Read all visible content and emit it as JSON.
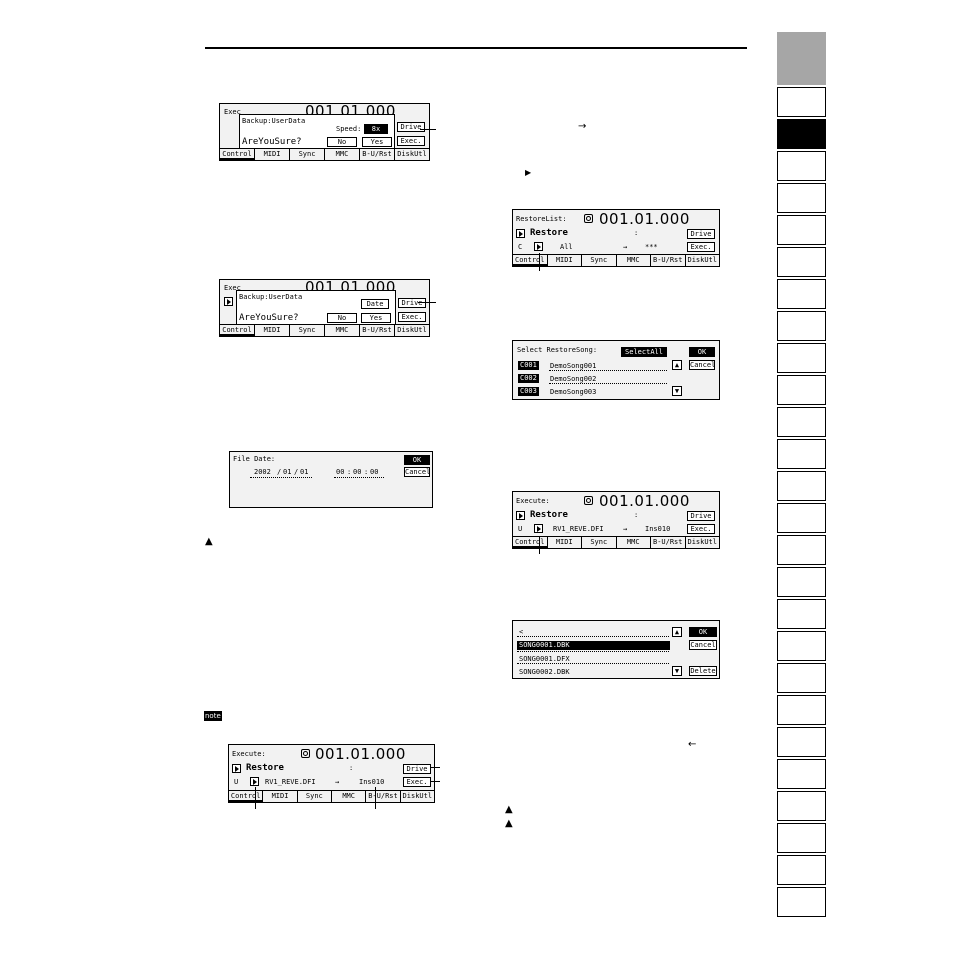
{
  "tabs": [
    "Control",
    "MIDI",
    "Sync",
    "MMC",
    "B-U/Rst",
    "DiskUtl"
  ],
  "scr1": {
    "title": "Backup:UserData",
    "speed_label": "Speed:",
    "speed_value": "8x",
    "drive": "Drive",
    "exec": "Exec.",
    "prompt": "AreYouSure?",
    "no": "No",
    "yes": "Yes",
    "head": "Exec",
    "time": "001.01.000"
  },
  "scr2": {
    "title": "Backup:UserData",
    "date": "Date",
    "drive": "Drive",
    "exec": "Exec.",
    "prompt": "AreYouSure?",
    "no": "No",
    "yes": "Yes",
    "head": "Exec",
    "time": "001.01.000"
  },
  "filedate": {
    "title": "File Date:",
    "year": "2002",
    "month": "01",
    "day": "01",
    "sep_date": "/",
    "h": "00",
    "m": "00",
    "s": "00",
    "sep_time": ":",
    "ok": "OK",
    "cancel": "Cancel"
  },
  "scr4": {
    "head": "Execute:",
    "time": "001.01.000",
    "mode": "Restore",
    "colon": ":",
    "src_prefix": "U",
    "src": "RV1_REVE.DFI",
    "arrow": "→",
    "dst": "Ins010",
    "drive": "Drive",
    "exec": "Exec."
  },
  "restorelist": {
    "head": "RestoreList:",
    "time": "001.01.000",
    "mode": "Restore",
    "colon": ":",
    "src_prefix": "C",
    "src": "All",
    "arrow": "→",
    "dst": "***",
    "drive": "Drive",
    "exec": "Exec."
  },
  "selectsong": {
    "title": "Select RestoreSong:",
    "selall": "SelectAll",
    "ok": "OK",
    "cancel": "Cancel",
    "rows": [
      {
        "num": "C001",
        "name": "DemoSong001"
      },
      {
        "num": "C002",
        "name": "DemoSong002"
      },
      {
        "num": "C003",
        "name": "DemoSong003"
      }
    ]
  },
  "scr7": {
    "head": "Execute:",
    "time": "001.01.000",
    "mode": "Restore",
    "colon": ":",
    "src_prefix": "U",
    "src": "RV1_REVE.DFI",
    "arrow": "→",
    "dst": "Ins010",
    "drive": "Drive",
    "exec": "Exec."
  },
  "filelist": {
    "path": "<",
    "ok": "OK",
    "cancel": "Cancel",
    "delete": "Delete",
    "files": [
      "SONG0001.DBK",
      "SONG0001.DFX",
      "SONG0002.DBK"
    ]
  },
  "glyphs": {
    "arrow_right": "→",
    "play": "▶",
    "arrow_left": "←",
    "note": "note"
  },
  "icons": {
    "caution": "caution-icon",
    "note": "note-icon"
  }
}
